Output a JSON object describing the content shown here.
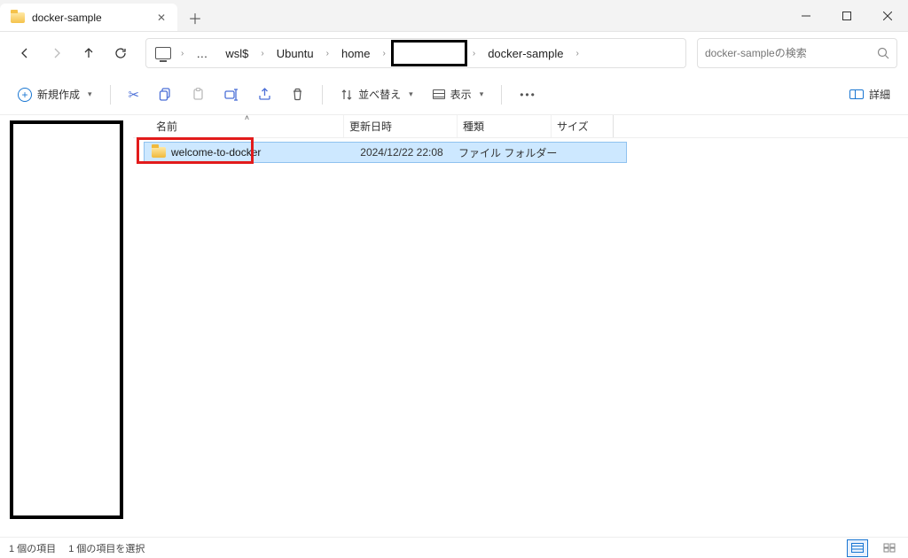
{
  "tab": {
    "title": "docker-sample"
  },
  "breadcrumbs": {
    "wsl": "wsl$",
    "ubuntu": "Ubuntu",
    "home": "home",
    "last": "docker-sample"
  },
  "search": {
    "placeholder": "docker-sampleの検索"
  },
  "toolbar": {
    "new": "新規作成",
    "sort": "並べ替え",
    "view": "表示",
    "details": "詳細"
  },
  "columns": {
    "name": "名前",
    "date": "更新日時",
    "kind": "種類",
    "size": "サイズ"
  },
  "rows": [
    {
      "name": "welcome-to-docker",
      "date": "2024/12/22 22:08",
      "kind": "ファイル フォルダー"
    }
  ],
  "status": {
    "count": "1 個の項目",
    "selected": "1 個の項目を選択"
  }
}
